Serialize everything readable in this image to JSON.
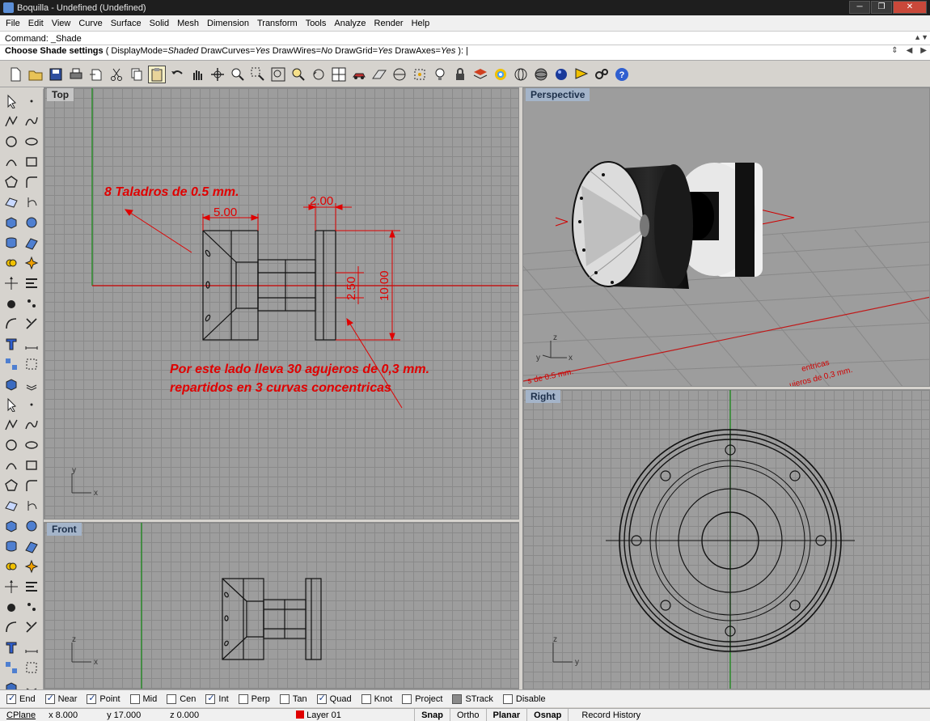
{
  "window": {
    "title": "Boquilla - Undefined (Undefined)"
  },
  "menu": [
    "File",
    "Edit",
    "View",
    "Curve",
    "Surface",
    "Solid",
    "Mesh",
    "Dimension",
    "Transform",
    "Tools",
    "Analyze",
    "Render",
    "Help"
  ],
  "command": {
    "line1": "Command: _Shade",
    "prompt_bold": "Choose Shade settings",
    "prompt_rest_1": " ( DisplayMode=",
    "display_mode": "Shaded",
    "prompt_rest_2": "  DrawCurves=",
    "draw_curves": "Yes",
    "prompt_rest_3": "  DrawWires=",
    "draw_wires": "No",
    "prompt_rest_4": "  DrawGrid=",
    "draw_grid": "Yes",
    "prompt_rest_5": "  DrawAxes=",
    "draw_axes": "Yes",
    "prompt_end": " ): "
  },
  "viewports": {
    "top": {
      "label": "Top",
      "note_taladros": "8 Taladros de 0.5 mm.",
      "note_lado_1": "Por este lado lleva 30 agujeros de 0,3 mm.",
      "note_lado_2": "repartidos en 3 curvas concentricas",
      "dim_5": "5.00",
      "dim_2": "2.00",
      "dim_250": "2.50",
      "dim_10": "10.00",
      "axis_x": "x",
      "axis_y": "y"
    },
    "perspective": {
      "label": "Perspective",
      "axis_x": "x",
      "axis_y": "y",
      "axis_z": "z",
      "ghost_text_1": "s de 0.5 mm.",
      "ghost_text_2": "ujeros de 0,3 mm.",
      "ghost_text_3": "entricas"
    },
    "front": {
      "label": "Front",
      "axis_x": "x",
      "axis_z": "z"
    },
    "right": {
      "label": "Right",
      "axis_y": "y",
      "axis_z": "z"
    }
  },
  "osnap": [
    {
      "label": "End",
      "checked": true
    },
    {
      "label": "Near",
      "checked": true
    },
    {
      "label": "Point",
      "checked": true
    },
    {
      "label": "Mid",
      "checked": false
    },
    {
      "label": "Cen",
      "checked": false
    },
    {
      "label": "Int",
      "checked": true
    },
    {
      "label": "Perp",
      "checked": false
    },
    {
      "label": "Tan",
      "checked": false
    },
    {
      "label": "Quad",
      "checked": true
    },
    {
      "label": "Knot",
      "checked": false
    },
    {
      "label": "Project",
      "checked": false
    },
    {
      "label": "STrack",
      "checked": false,
      "grey": true
    },
    {
      "label": "Disable",
      "checked": false
    }
  ],
  "status": {
    "cplane": "CPlane",
    "x": "x 8.000",
    "y": "y 17.000",
    "z": "z 0.000",
    "layer": "Layer 01",
    "snap": "Snap",
    "ortho": "Ortho",
    "planar": "Planar",
    "osnap": "Osnap",
    "history": "Record History"
  },
  "colors": {
    "dimension_red": "#e00000",
    "viewport_grid": "#9d9d9d",
    "label_bg": "#a4b4c9"
  }
}
